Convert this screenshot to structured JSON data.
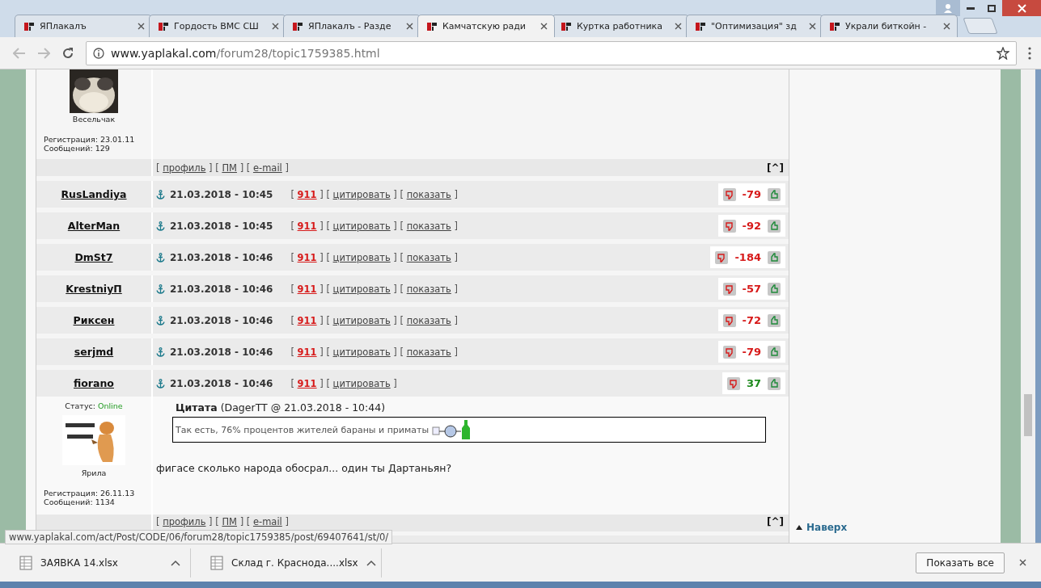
{
  "tabs": [
    {
      "title": "ЯПлакалъ",
      "selected": false
    },
    {
      "title": "Гордость ВМС СШ",
      "selected": false
    },
    {
      "title": "ЯПлакалъ - Разде",
      "selected": false
    },
    {
      "title": "Камчатскую ради",
      "selected": true
    },
    {
      "title": "Куртка работника",
      "selected": false
    },
    {
      "title": "\"Оптимизация\" зд",
      "selected": false
    },
    {
      "title": "Украли биткойн -",
      "selected": false
    }
  ],
  "address": {
    "domain": "www.yaplakal.com",
    "path": "/forum28/topic1759385.html"
  },
  "top_post": {
    "author": "Весельчак",
    "registration": "Регистрация: 23.01.11",
    "messages": "Сообщений: 129",
    "links": [
      {
        "kind": "text",
        "text": "[ "
      },
      {
        "kind": "link",
        "text": "профиль"
      },
      {
        "kind": "text",
        "text": " ] [ "
      },
      {
        "kind": "link",
        "text": "ПМ"
      },
      {
        "kind": "text",
        "text": " ] [ "
      },
      {
        "kind": "link",
        "text": "e-mail"
      },
      {
        "kind": "text",
        "text": " ]"
      }
    ],
    "up_link": "[^]"
  },
  "posts": [
    {
      "author": "RusLandiya",
      "date": "21.03.2018 - 10:45",
      "actions": [
        {
          "kind": "text",
          "text": "[ "
        },
        {
          "kind": "number",
          "text": "911"
        },
        {
          "kind": "text",
          "text": " ] [ "
        },
        {
          "kind": "link",
          "text": "цитировать"
        },
        {
          "kind": "text",
          "text": " ] [ "
        },
        {
          "kind": "link",
          "text": "показать"
        },
        {
          "kind": "text",
          "text": " ]"
        }
      ],
      "rating": "-79",
      "color": "#d71a1a"
    },
    {
      "author": "AlterMan",
      "date": "21.03.2018 - 10:45",
      "actions": [
        {
          "kind": "text",
          "text": "[ "
        },
        {
          "kind": "number",
          "text": "911"
        },
        {
          "kind": "text",
          "text": " ] [ "
        },
        {
          "kind": "link",
          "text": "цитировать"
        },
        {
          "kind": "text",
          "text": " ] [ "
        },
        {
          "kind": "link",
          "text": "показать"
        },
        {
          "kind": "text",
          "text": " ]"
        }
      ],
      "rating": "-92",
      "color": "#d71a1a"
    },
    {
      "author": "DmSt7",
      "date": "21.03.2018 - 10:46",
      "actions": [
        {
          "kind": "text",
          "text": "[ "
        },
        {
          "kind": "number",
          "text": "911"
        },
        {
          "kind": "text",
          "text": " ] [ "
        },
        {
          "kind": "link",
          "text": "цитировать"
        },
        {
          "kind": "text",
          "text": " ] [ "
        },
        {
          "kind": "link",
          "text": "показать"
        },
        {
          "kind": "text",
          "text": " ]"
        }
      ],
      "rating": "-184",
      "color": "#d71a1a"
    },
    {
      "author": "KrestniyП",
      "date": "21.03.2018 - 10:46",
      "actions": [
        {
          "kind": "text",
          "text": "[ "
        },
        {
          "kind": "number",
          "text": "911"
        },
        {
          "kind": "text",
          "text": " ] [ "
        },
        {
          "kind": "link",
          "text": "цитировать"
        },
        {
          "kind": "text",
          "text": " ] [ "
        },
        {
          "kind": "link",
          "text": "показать"
        },
        {
          "kind": "text",
          "text": " ]"
        }
      ],
      "rating": "-57",
      "color": "#d71a1a"
    },
    {
      "author": "Риксен",
      "date": "21.03.2018 - 10:46",
      "actions": [
        {
          "kind": "text",
          "text": "[ "
        },
        {
          "kind": "number",
          "text": "911"
        },
        {
          "kind": "text",
          "text": " ] [ "
        },
        {
          "kind": "link",
          "text": "цитировать"
        },
        {
          "kind": "text",
          "text": " ] [ "
        },
        {
          "kind": "link",
          "text": "показать"
        },
        {
          "kind": "text",
          "text": " ]"
        }
      ],
      "rating": "-72",
      "color": "#d71a1a"
    },
    {
      "author": "serjmd",
      "date": "21.03.2018 - 10:46",
      "actions": [
        {
          "kind": "text",
          "text": "[ "
        },
        {
          "kind": "number",
          "text": "911"
        },
        {
          "kind": "text",
          "text": " ] [ "
        },
        {
          "kind": "link",
          "text": "цитировать"
        },
        {
          "kind": "text",
          "text": " ] [ "
        },
        {
          "kind": "link",
          "text": "показать"
        },
        {
          "kind": "text",
          "text": " ]"
        }
      ],
      "rating": "-79",
      "color": "#d71a1a"
    },
    {
      "author": "fiorano",
      "date": "21.03.2018 - 10:46",
      "actions": [
        {
          "kind": "text",
          "text": "[ "
        },
        {
          "kind": "number",
          "text": "911"
        },
        {
          "kind": "text",
          "text": " ] [ "
        },
        {
          "kind": "link",
          "text": "цитировать"
        },
        {
          "kind": "text",
          "text": " ]"
        }
      ],
      "rating": "37",
      "color": "#1f8a1f"
    }
  ],
  "open_post": {
    "status_label": "Статус:",
    "status": "Online",
    "author": "Ярила",
    "registration": "Регистрация: 26.11.13",
    "messages": "Сообщений: 1134",
    "quote_title": "Цитата",
    "quote_meta": "(DagerTT @ 21.03.2018 - 10:44)",
    "quote_text": "Так есть, 76% процентов жителей бараны и приматы",
    "body": "фигасе сколько народа обосрал... один ты Дартаньян?",
    "links": [
      {
        "kind": "text",
        "text": "[ "
      },
      {
        "kind": "link",
        "text": "профиль"
      },
      {
        "kind": "text",
        "text": " ] [ "
      },
      {
        "kind": "link",
        "text": "ПМ"
      },
      {
        "kind": "text",
        "text": " ] [ "
      },
      {
        "kind": "link",
        "text": "e-mail"
      },
      {
        "kind": "text",
        "text": " ]"
      }
    ],
    "up_link": "[^]"
  },
  "side": {
    "to_top": "Наверх"
  },
  "status_url": "www.yaplakal.com/act/Post/CODE/06/forum28/topic1759385/post/69407641/st/0/",
  "downloads": [
    {
      "name": "ЗАЯВКА 14.xlsx"
    },
    {
      "name": "Склад г. Краснода....xlsx"
    }
  ],
  "show_all": "Показать все"
}
